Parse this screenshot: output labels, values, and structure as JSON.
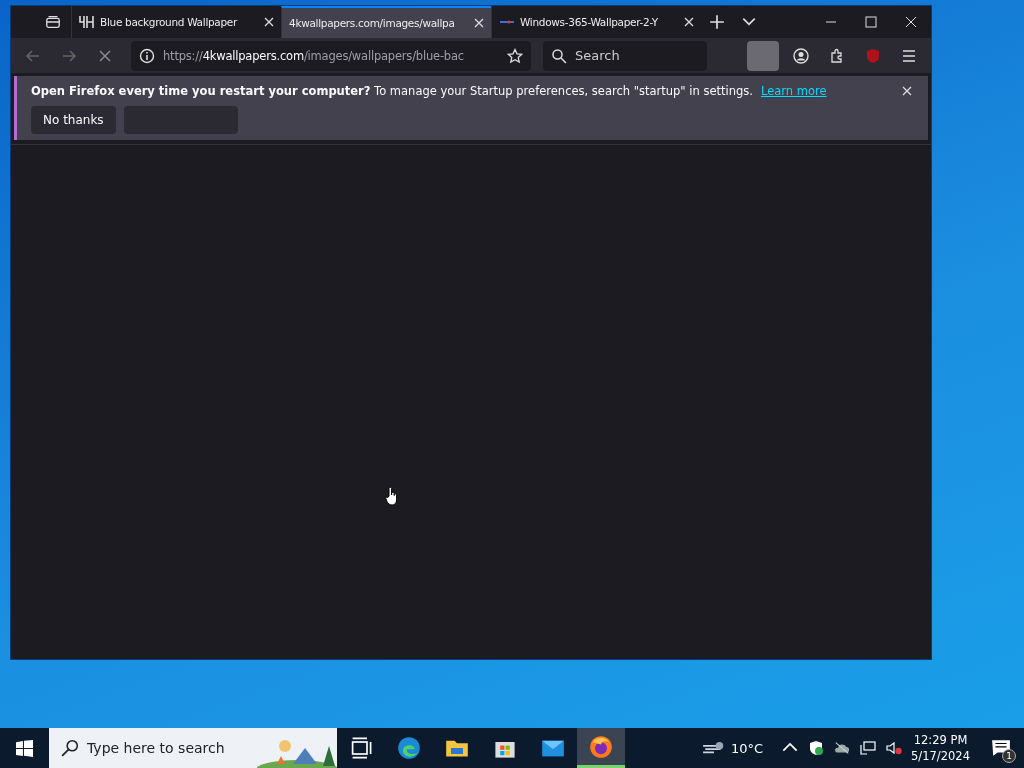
{
  "browser": {
    "tabs": [
      {
        "title": "Blue background Wallpaper",
        "kind": "site",
        "selected": false
      },
      {
        "title": "4kwallpapers.com/images/wallpa",
        "kind": "loading",
        "selected": true
      },
      {
        "title": "Windows-365-Wallpaper-2-Y",
        "kind": "image",
        "selected": false
      }
    ],
    "address": {
      "scheme": "https://",
      "host": "4kwallpapers.com",
      "path": "/images/wallpapers/blue-bac"
    },
    "search": {
      "placeholder": "Search"
    },
    "notification": {
      "message": "**Open Firefox every time you restart your computer?** To manage your Startup preferences, search \"startup\" in settings.",
      "link": "Learn more",
      "buttons": [
        "No thanks"
      ]
    }
  },
  "taskbar": {
    "search": {
      "placeholder": "Type here to search"
    },
    "apps": [
      {
        "kind": "taskview",
        "selected": false
      },
      {
        "kind": "edge",
        "selected": false
      },
      {
        "kind": "explorer",
        "selected": false
      },
      {
        "kind": "store",
        "selected": false
      },
      {
        "kind": "mail",
        "selected": false
      },
      {
        "kind": "firefox",
        "selected": true
      }
    ],
    "weather": "10°C",
    "time": "12:29 PM",
    "date": "5/17/2024",
    "notifications": "1"
  }
}
